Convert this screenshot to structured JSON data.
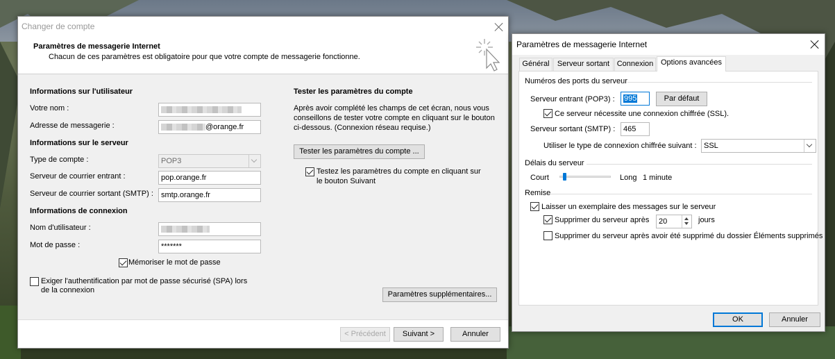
{
  "left_dialog": {
    "title": "Changer de compte",
    "header_title": "Paramètres de messagerie Internet",
    "header_subtitle": "Chacun de ces paramètres est obligatoire pour que votre compte de messagerie fonctionne.",
    "user_section": "Informations sur l'utilisateur",
    "name_label": "Votre nom :",
    "email_label": "Adresse de messagerie :",
    "email_suffix": "@orange.fr",
    "server_section": "Informations sur le serveur",
    "account_type_label": "Type de compte :",
    "account_type_value": "POP3",
    "incoming_label": "Serveur de courrier entrant :",
    "incoming_value": "pop.orange.fr",
    "outgoing_label": "Serveur de courrier sortant (SMTP) :",
    "outgoing_value": "smtp.orange.fr",
    "login_section": "Informations de connexion",
    "username_label": "Nom d'utilisateur :",
    "password_label": "Mot de passe :",
    "password_value": "*******",
    "remember_password": "Mémoriser le mot de passe",
    "spa_line1": "Exiger l'authentification par mot de passe sécurisé (SPA) lors",
    "spa_line2": "de la connexion",
    "test_section": "Tester les paramètres du compte",
    "test_desc_1": "Après avoir complété les champs de cet écran, nous vous",
    "test_desc_2": "conseillons de tester votre compte en cliquant sur le bouton",
    "test_desc_3": "ci-dessous. (Connexion réseau requise.)",
    "test_button": "Tester les paramètres du compte ...",
    "test_next_1": "Testez les paramètres du compte en cliquant sur",
    "test_next_2": "le bouton Suivant",
    "more_settings": "Paramètres supplémentaires...",
    "prev_button": "< Précédent",
    "next_button": "Suivant >",
    "cancel_button": "Annuler"
  },
  "right_dialog": {
    "title": "Paramètres de messagerie Internet",
    "tabs": [
      "Général",
      "Serveur sortant",
      "Connexion",
      "Options avancées"
    ],
    "ports_section": "Numéros des ports du serveur",
    "incoming_label": "Serveur entrant (POP3) :",
    "incoming_port": "995",
    "default_button": "Par défaut",
    "ssl_label": "Ce serveur nécessite une connexion chiffrée (SSL).",
    "outgoing_label": "Serveur sortant (SMTP) :",
    "outgoing_port": "465",
    "encryption_label": "Utiliser le type de connexion chiffrée suivant :",
    "encryption_value": "SSL",
    "timeout_section": "Délais du serveur",
    "short_label": "Court",
    "long_label": "Long",
    "timeout_value": "1 minute",
    "timeout_fraction": 0.07,
    "delivery_section": "Remise",
    "keep_copy": "Laisser un exemplaire des messages sur le serveur",
    "remove_after": "Supprimer du serveur après",
    "days_value": "20",
    "days_label": "jours",
    "remove_deleted": "Supprimer du serveur après avoir été supprimé du dossier Éléments supprimés",
    "ok_button": "OK",
    "cancel_button": "Annuler"
  }
}
